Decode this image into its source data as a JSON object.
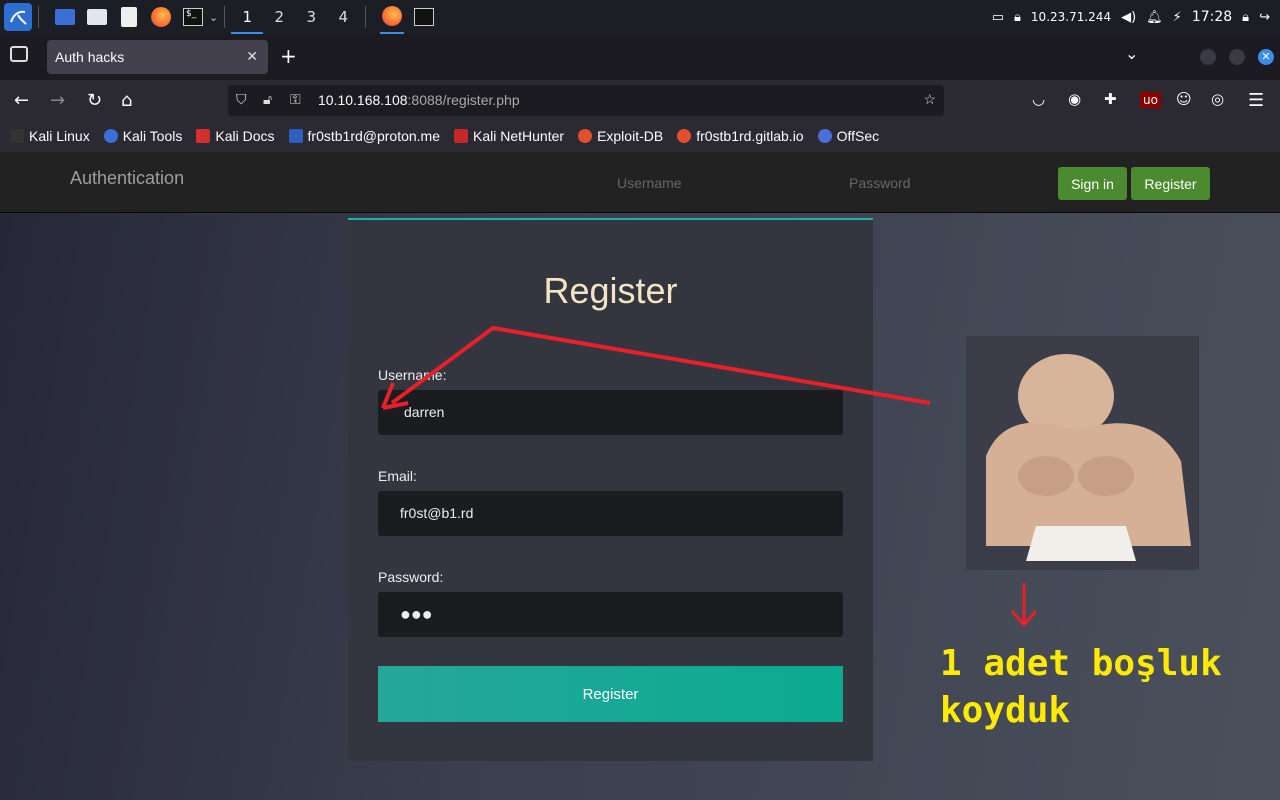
{
  "taskbar": {
    "workspaces": [
      "1",
      "2",
      "3",
      "4"
    ],
    "ip": "10.23.71.244",
    "time": "17:28"
  },
  "browser": {
    "tab_title": "Auth hacks",
    "url_host": "10.10.168.108",
    "url_rest": ":8088/register.php",
    "bookmarks": [
      "Kali Linux",
      "Kali Tools",
      "Kali Docs",
      "fr0stb1rd@proton.me",
      "Kali NetHunter",
      "Exploit-DB",
      "fr0stb1rd.gitlab.io",
      "OffSec"
    ]
  },
  "header": {
    "brand": "Authentication",
    "username_placeholder": "Username",
    "password_placeholder": "Password",
    "signin_label": "Sign in",
    "register_label": "Register"
  },
  "form": {
    "title": "Register",
    "username_label": "Username:",
    "username_value": "darren",
    "email_label": "Email:",
    "email_value": "fr0st@b1.rd",
    "password_label": "Password:",
    "password_value": "●●●",
    "submit_label": "Register"
  },
  "annotation": {
    "caption_line1": "1 adet boşluk",
    "caption_line2": "koyduk",
    "arrow_color": "#e8202a",
    "caption_color": "#ffea00"
  },
  "colors": {
    "accent": "#19b3a6",
    "header_btn": "#4b8a2e"
  }
}
